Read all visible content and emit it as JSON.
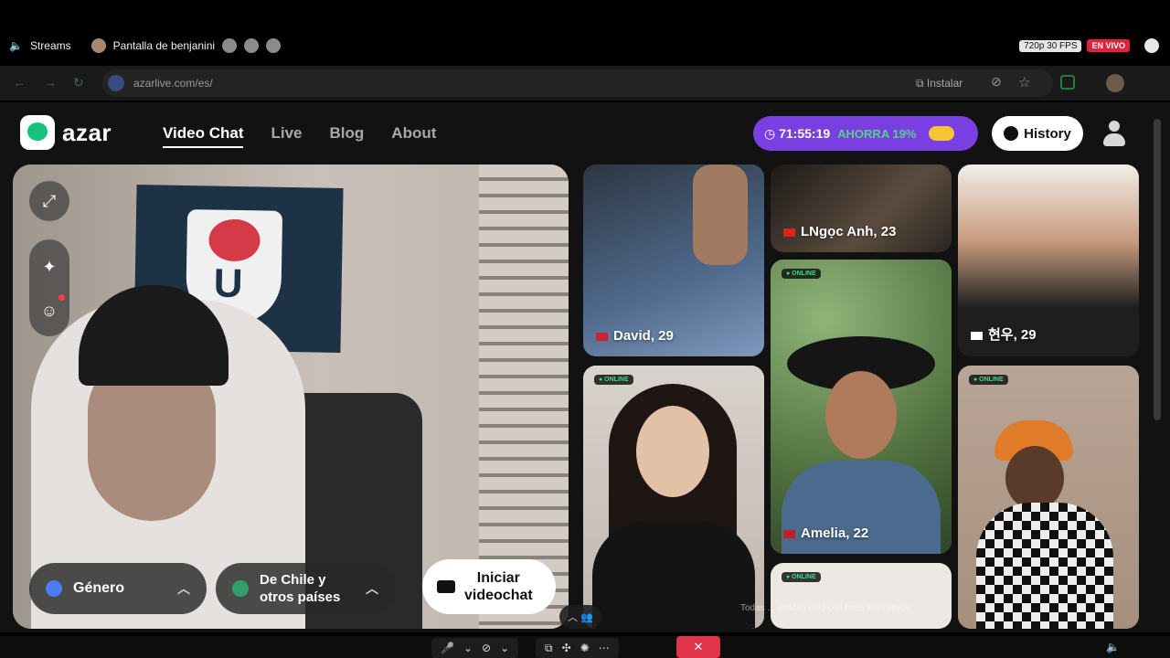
{
  "stream": {
    "label": "Streams",
    "screen_label": "Pantalla de benjanini",
    "resolution": "720p 30 FPS",
    "live": "EN VIVO"
  },
  "browser": {
    "url": "azarlive.com/es/",
    "install_label": "Instalar"
  },
  "site": {
    "logo_text": "azar",
    "nav": [
      "Video Chat",
      "Live",
      "Blog",
      "About"
    ],
    "promo_timer": "71:55:19",
    "promo_save": "AHORRA 19%",
    "history_label": "History"
  },
  "controls": {
    "gender_label": "Género",
    "region_line1": "De Chile y",
    "region_line2": "otros países",
    "start_line1": "Iniciar",
    "start_line2": "videochat"
  },
  "profiles": [
    {
      "name": "David, 29",
      "online": false
    },
    {
      "name": "LNgọc Anh, 23",
      "online": false
    },
    {
      "name": "현우, 29",
      "online": false
    },
    {
      "name": "",
      "online": true
    },
    {
      "name": "Amelia, 22",
      "online": true
    },
    {
      "name": "",
      "online": true
    },
    {
      "name": "",
      "online": true
    }
  ],
  "online_label": "● ONLINE",
  "disclaimer": "Todas ... utilizan solo con fines ilustrativos."
}
